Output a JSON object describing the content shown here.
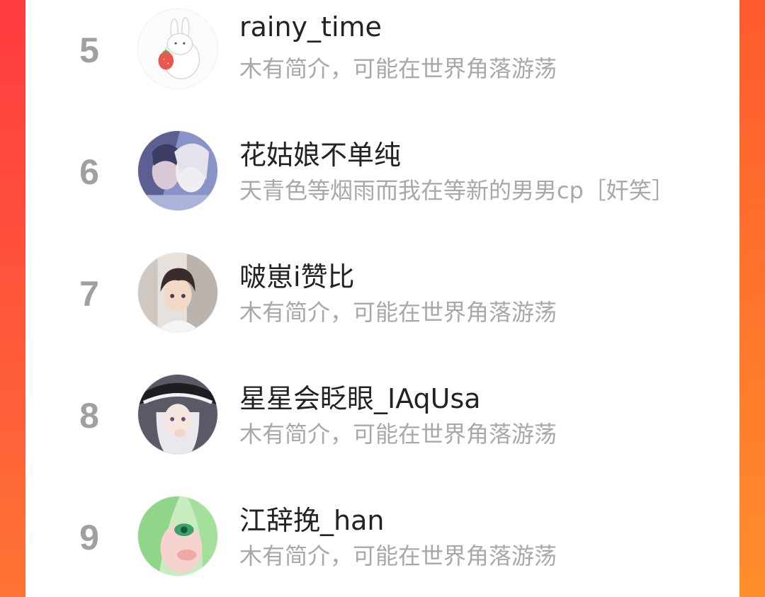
{
  "ranking": {
    "items": [
      {
        "rank": "5",
        "name": "rainy_time",
        "bio": "木有简介，可能在世界角落游荡",
        "avatar": "rabbit-strawberry-avatar"
      },
      {
        "rank": "6",
        "name": "花姑娘不单纯",
        "bio": "天青色等烟雨而我在等新的男男cp［奸笑］",
        "avatar": "anime-couple-avatar"
      },
      {
        "rank": "7",
        "name": "啵崽i赞比",
        "bio": "木有简介，可能在世界角落游荡",
        "avatar": "anime-boy-avatar"
      },
      {
        "rank": "8",
        "name": "星星会眨眼_IAqUsa",
        "bio": "木有简介，可能在世界角落游荡",
        "avatar": "witch-girl-avatar"
      },
      {
        "rank": "9",
        "name": "江辞挽_han",
        "bio": "木有简介，可能在世界角落游荡",
        "avatar": "green-hair-girl-avatar"
      }
    ]
  },
  "colors": {
    "background_accent": "#ff5a35",
    "rank_number": "#a0a0a0",
    "name_text": "#222222",
    "bio_text": "#a8a8a8"
  }
}
